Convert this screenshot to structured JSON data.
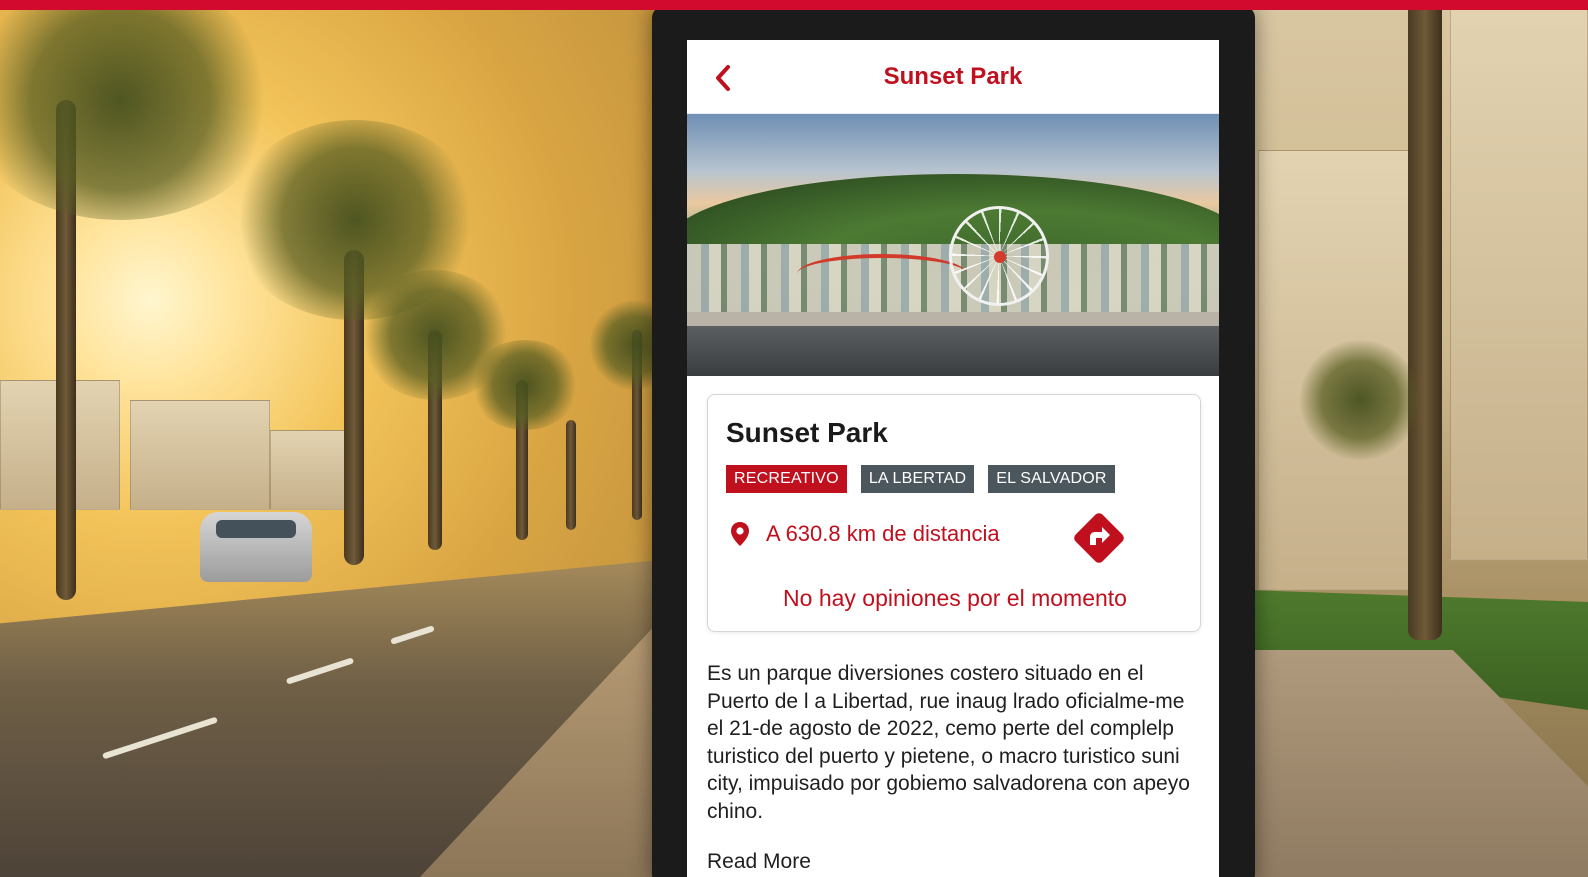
{
  "colors": {
    "brand_red": "#c0101e",
    "top_bar": "#d10a2e",
    "tag_dark": "#4c565d"
  },
  "header": {
    "back_icon": "chevron-left-icon",
    "title": "Sunset Park"
  },
  "hero": {
    "image_subject": "park-photo"
  },
  "place": {
    "name": "Sunset Park",
    "tags": [
      {
        "label": "RECREATIVO",
        "style": "primary"
      },
      {
        "label": "LA LBERTAD",
        "style": "dark"
      },
      {
        "label": "EL SALVADOR",
        "style": "dark"
      }
    ],
    "location_icon": "map-pin-icon",
    "distance": "A 630.8 km de distancia",
    "directions_icon": "directions-icon",
    "reviews_status": "No hay opiniones por el momento"
  },
  "description": {
    "text": "Es un parque diversiones costero situado en el Puerto de l a Libertad, rue inaug lrado oficialme-me el 21-de agosto de 2022, cemo perte del complelp turistico del puerto y pietene, o macro turistico suni city, impuisado por gobiemo salvadorena con apeyo chino.",
    "read_more": "Read More"
  }
}
